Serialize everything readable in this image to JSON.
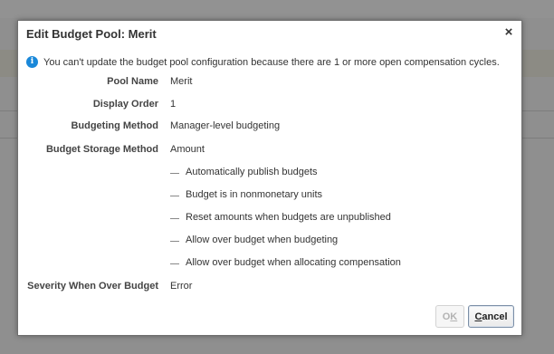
{
  "dialog": {
    "title": "Edit Budget Pool: Merit",
    "close_glyph": "×",
    "info_icon": "info-icon",
    "info_message": "You can't update the budget pool configuration because there are 1 or more open compensation cycles."
  },
  "fields": [
    {
      "label": "Pool Name",
      "value": "Merit"
    },
    {
      "label": "Display Order",
      "value": "1"
    },
    {
      "label": "Budgeting Method",
      "value": "Manager-level budgeting"
    },
    {
      "label": "Budget Storage Method",
      "value": "Amount"
    }
  ],
  "checkboxes": [
    {
      "label": "Automatically publish budgets",
      "checked": false
    },
    {
      "label": "Budget is in nonmonetary units",
      "checked": false
    },
    {
      "label": "Reset amounts when budgets are unpublished",
      "checked": false
    },
    {
      "label": "Allow over budget when budgeting",
      "checked": false
    },
    {
      "label": "Allow over budget when allocating compensation",
      "checked": false
    }
  ],
  "severity": {
    "label": "Severity When Over Budget",
    "value": "Error"
  },
  "buttons": {
    "ok": {
      "first": "O",
      "mnemonic": "K",
      "rest": "",
      "disabled": true
    },
    "cancel": {
      "first": "",
      "mnemonic": "C",
      "rest": "ancel"
    }
  }
}
